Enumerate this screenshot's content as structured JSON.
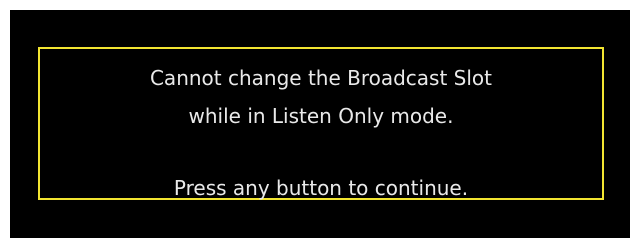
{
  "dialog": {
    "lines": [
      "Cannot change the Broadcast Slot",
      "while in Listen Only mode.",
      "Press any button to continue."
    ]
  },
  "colors": {
    "background": "#000000",
    "border": "#f2e531",
    "text": "#e9e9e9",
    "page": "#ffffff"
  }
}
